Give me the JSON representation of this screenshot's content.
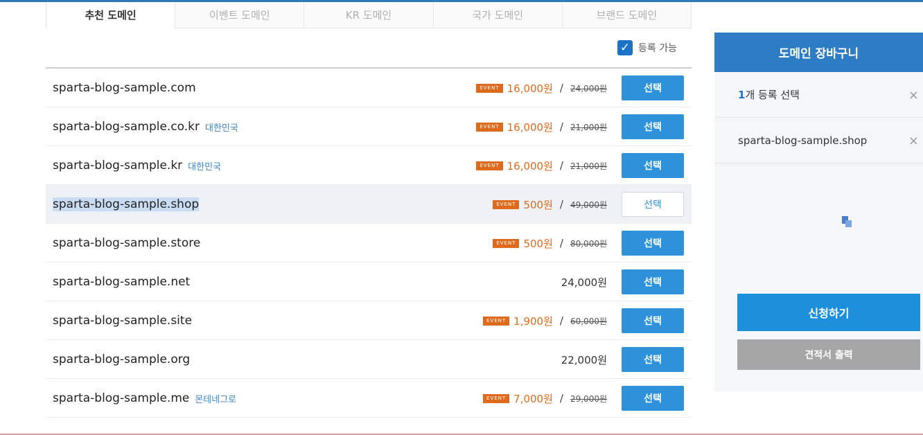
{
  "tabs": [
    "추천 도메인",
    "이벤트 도메인",
    "KR 도메인",
    "국가 도메인",
    "브랜드 도메인"
  ],
  "filter": {
    "label": "등록 가능",
    "checked": true
  },
  "badge_text": "EVENT",
  "select_label": "선택",
  "rows": [
    {
      "domain": "sparta-blog-sample.com",
      "country": "",
      "event": true,
      "sale_price": "16,000원",
      "original_price": "24,000원"
    },
    {
      "domain": "sparta-blog-sample.co.kr",
      "country": "대한민국",
      "event": true,
      "sale_price": "16,000원",
      "original_price": "21,000원"
    },
    {
      "domain": "sparta-blog-sample.kr",
      "country": "대한민국",
      "event": true,
      "sale_price": "16,000원",
      "original_price": "21,000원"
    },
    {
      "domain": "sparta-blog-sample.shop",
      "country": "",
      "event": true,
      "sale_price": "500원",
      "original_price": "49,000원",
      "selected": true
    },
    {
      "domain": "sparta-blog-sample.store",
      "country": "",
      "event": true,
      "sale_price": "500원",
      "original_price": "80,000원"
    },
    {
      "domain": "sparta-blog-sample.net",
      "country": "",
      "event": false,
      "price": "24,000원"
    },
    {
      "domain": "sparta-blog-sample.site",
      "country": "",
      "event": true,
      "sale_price": "1,900원",
      "original_price": "60,000원"
    },
    {
      "domain": "sparta-blog-sample.org",
      "country": "",
      "event": false,
      "price": "22,000원"
    },
    {
      "domain": "sparta-blog-sample.me",
      "country": "몬테네그로",
      "event": true,
      "sale_price": "7,000원",
      "original_price": "29,000원"
    }
  ],
  "cart": {
    "title": "도메인 장바구니",
    "count_num": "1",
    "count_text": "개 등록 선택",
    "items": [
      "sparta-blog-sample.shop"
    ],
    "apply_label": "신청하기",
    "quote_label": "견적서 출력",
    "close_glyph": "×"
  },
  "colors": {
    "accent": "#2d92d9",
    "header": "#2d7cc4",
    "event": "#e06a1b",
    "selected_row": "#eef1f6"
  }
}
